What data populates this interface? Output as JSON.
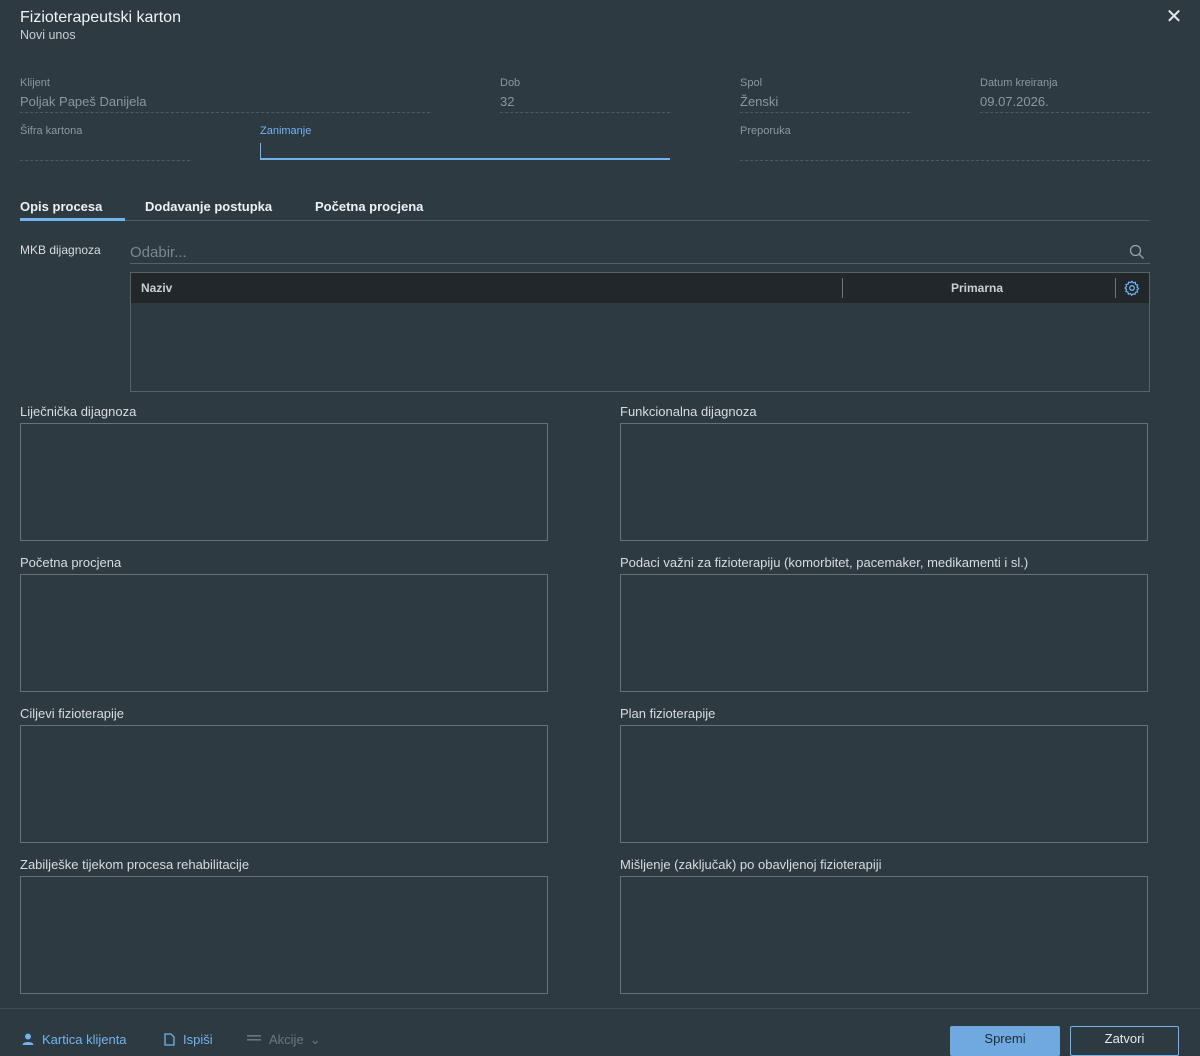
{
  "dialog": {
    "title": "Fizioterapeutski karton",
    "subtitle": "Novi unos",
    "close_glyph": "✕"
  },
  "fields": {
    "klijent": {
      "label": "Klijent",
      "value": "Poljak Papeš Danijela"
    },
    "dob": {
      "label": "Dob",
      "value": "32"
    },
    "spol": {
      "label": "Spol",
      "value": "Ženski"
    },
    "datum": {
      "label": "Datum kreiranja",
      "value": "09.07.2026."
    },
    "sifra": {
      "label": "Šifra kartona",
      "value": ""
    },
    "zanimanje": {
      "label": "Zanimanje",
      "value": ""
    },
    "preporuka": {
      "label": "Preporuka",
      "value": ""
    }
  },
  "tabs": [
    {
      "label": "Opis procesa",
      "active": true
    },
    {
      "label": "Dodavanje postupka",
      "active": false
    },
    {
      "label": "Početna procjena",
      "active": false
    }
  ],
  "mkb": {
    "label": "MKB dijagnoza",
    "placeholder": "Odabir...",
    "grid": {
      "col_naziv": "Naziv",
      "col_primarna": "Primarna"
    }
  },
  "textareas": {
    "lijecnicka": "Liječnička dijagnoza",
    "funkcionalna": "Funkcionalna dijagnoza",
    "pocetna": "Početna procjena",
    "podaci": "Podaci važni za fizioterapiju (komorbitet, pacemaker, medikamenti i sl.)",
    "ciljevi": "Ciljevi fizioterapije",
    "plan": "Plan fizioterapije",
    "zabiljeske": "Zabilješke tijekom procesa rehabilitacije",
    "misljenje": "Mišljenje (zaključak) po obavljenoj fizioterapiji"
  },
  "footer": {
    "kartica": "Kartica klijenta",
    "ispisi": "Ispiši",
    "akcije": "Akcije",
    "spremi": "Spremi",
    "zatvori": "Zatvori"
  },
  "colors": {
    "background": "#2e3a41",
    "accent": "#6fb3f0",
    "grid_header": "#21272b"
  }
}
